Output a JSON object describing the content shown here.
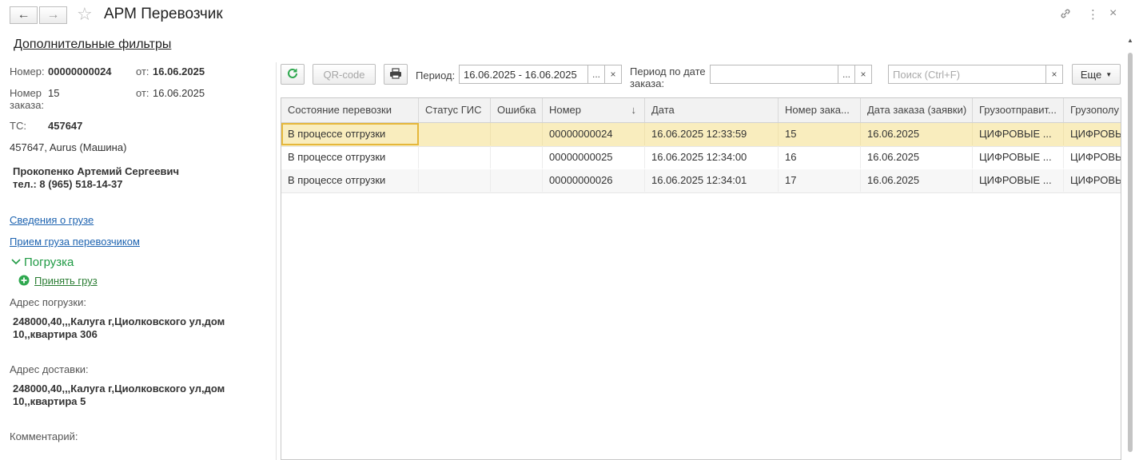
{
  "window": {
    "title": "АРМ Перевозчик",
    "back_icon": "arrow-left-icon",
    "forward_icon": "arrow-right-icon",
    "favorite_icon": "star-icon"
  },
  "header": {
    "filters_link": "Дополнительные фильтры"
  },
  "left_panel": {
    "number_label": "Номер:",
    "number_value": "00000000024",
    "number_date_label": "от:",
    "number_date_value": "16.06.2025",
    "order_label_1": "Номер",
    "order_label_2": "заказа:",
    "order_value": "15",
    "order_date_label": "от:",
    "order_date_value": "16.06.2025",
    "vehicle_label": "ТС:",
    "vehicle_value": "457647",
    "vehicle_desc": "457647, Aurus (Машина)",
    "driver_name": "Прокопенко Артемий Сергеевич",
    "driver_phone": "тел.: 8 (965) 518-14-37",
    "cargo_info_link": "Сведения о грузе",
    "cargo_accept_link": "Прием груза перевозчиком",
    "loading_section": "Погрузка",
    "accept_cargo_link": "Принять груз",
    "loading_address_label": "Адрес погрузки:",
    "loading_address_line1": "248000,40,,,Калуга г,Циолковского ул,дом",
    "loading_address_line2": "10,,квартира 306",
    "delivery_address_label": "Адрес доставки:",
    "delivery_address_line1": "248000,40,,,Калуга г,Циолковского ул,дом",
    "delivery_address_line2": "10,,квартира 5",
    "comment_label": "Комментарий:"
  },
  "toolbar": {
    "qr_button": "QR-code",
    "period_label": "Период:",
    "period_value": "16.06.2025 - 16.06.2025",
    "order_period_label_1": "Период по дате",
    "order_period_label_2": "заказа:",
    "order_period_value": "",
    "search_placeholder": "Поиск (Ctrl+F)",
    "more_button": "Еще",
    "ellipsis": "...",
    "clear": "×"
  },
  "table": {
    "columns": [
      "Состояние перевозки",
      "Статус ГИС",
      "Ошибка",
      "Номер",
      "Дата",
      "Номер зака...",
      "Дата заказа (заявки)",
      "Грузоотправит...",
      "Грузополу"
    ],
    "sort_arrow": "↓",
    "rows": [
      [
        "В процессе отгрузки",
        "",
        "",
        "00000000024",
        "16.06.2025 12:33:59",
        "15",
        "16.06.2025",
        "ЦИФРОВЫЕ ...",
        "ЦИФРОВЫ"
      ],
      [
        "В процессе отгрузки",
        "",
        "",
        "00000000025",
        "16.06.2025 12:34:00",
        "16",
        "16.06.2025",
        "ЦИФРОВЫЕ ...",
        "ЦИФРОВЫ"
      ],
      [
        "В процессе отгрузки",
        "",
        "",
        "00000000026",
        "16.06.2025 12:34:01",
        "17",
        "16.06.2025",
        "ЦИФРОВЫЕ ...",
        "ЦИФРОВЫ"
      ]
    ]
  },
  "colors": {
    "accent_green": "#1f9a44",
    "link_blue": "#1d63b0",
    "selected_row": "#f9edbe"
  }
}
